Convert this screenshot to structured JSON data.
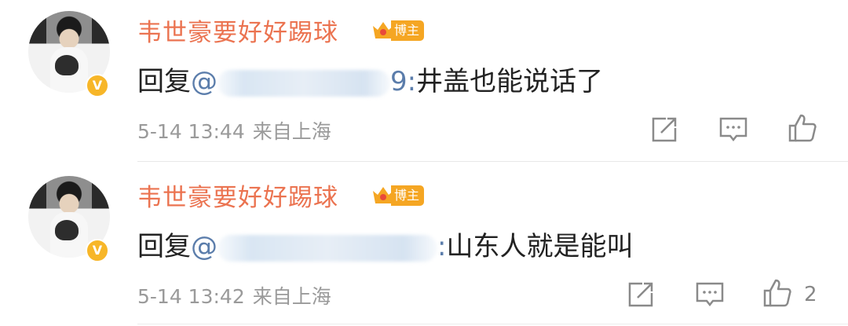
{
  "comments": [
    {
      "username": "韦世豪要好好踢球",
      "tag": "博主",
      "verified_mark": "V",
      "reply_prefix": "回复",
      "at_sign": "@",
      "mention_suffix": "9:",
      "reply_text": "井盖也能说话了",
      "time": "5-14 13:44",
      "source": "来自上海",
      "like_count": ""
    },
    {
      "username": "韦世豪要好好踢球",
      "tag": "博主",
      "verified_mark": "V",
      "reply_prefix": "回复",
      "at_sign": "@",
      "mention_suffix": ":",
      "reply_text": "山东人就是能叫",
      "time": "5-14 13:42",
      "source": "来自上海",
      "like_count": "2"
    }
  ],
  "icons": [
    "share-icon",
    "comment-icon",
    "like-icon",
    "crown-icon",
    "verified-icon"
  ],
  "colors": {
    "username": "#eb7350",
    "tag": "#f5a623",
    "mention": "#5b7dab",
    "meta": "#9a9a9a"
  }
}
